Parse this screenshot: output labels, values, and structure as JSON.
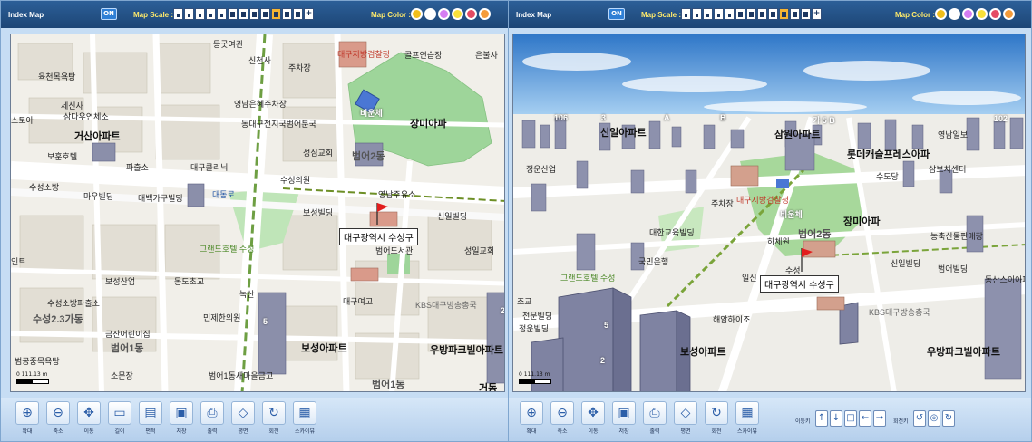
{
  "left": {
    "title": "Index Map",
    "on": "ON",
    "scale_label": "Map Scale :",
    "color_label": "Map Color :",
    "zoom_plus": "+",
    "callout": "대구광역시 수성구",
    "scalebar": "0 111.13 m",
    "labels": {
      "l01": "등굿여관",
      "l02": "신천사",
      "l03": "주차장",
      "l04": "대구지방검찰청",
      "l05": "골프연습장",
      "l06": "은불사",
      "l07": "육천목욕탕",
      "l08": "세신사",
      "l09": "삼다우연체소",
      "l10": "영남은혜주차장",
      "l11": "동대구전지국범어분국",
      "l12": "비운체",
      "l13": "장미아파",
      "l14": "거산아파트",
      "l15": "파출소",
      "l16": "성심교회",
      "l17": "범어2동",
      "l18": "보훈호텔",
      "l19": "대구클리닉",
      "l20": "수성의원",
      "l21": "영남주유소",
      "l22": "수성소방",
      "l23": "마우빌딩",
      "l24": "대백가구빌딩",
      "l25": "대동로",
      "l26": "보성빌딩",
      "l27": "신일빌딩",
      "l28": "그랜드호텔 수성",
      "l29": "범어도서관",
      "l30": "성일교회",
      "l31": "보성산업",
      "l32": "동도초교",
      "l33": "녹산",
      "l34": "대구여고",
      "l35": "KBS대구방송총국",
      "l36": "수성2.3가동",
      "l37": "민제한의원",
      "l38": "금잔어린이집",
      "l39": "범어1동",
      "l40": "보성아파트",
      "l41": "우방파크빌아파트",
      "l42": "범공중목욕탕",
      "l43": "소문장",
      "l44": "범어1동새마을금고",
      "l45": "범어1동",
      "l46": "수성소방파출소",
      "l47": "스토아",
      "l48": "인트",
      "l49": "5",
      "l50": "2",
      "l51": "거동"
    },
    "tools": [
      {
        "icon": "zoom-in-icon",
        "label": "확대"
      },
      {
        "icon": "zoom-out-icon",
        "label": "축소"
      },
      {
        "icon": "move-icon",
        "label": "이동"
      },
      {
        "icon": "ruler-icon",
        "label": "길이"
      },
      {
        "icon": "edit-icon",
        "label": "편적"
      },
      {
        "icon": "save-icon",
        "label": "저장"
      },
      {
        "icon": "print-icon",
        "label": "출력"
      },
      {
        "icon": "plane-icon",
        "label": "평면"
      },
      {
        "icon": "rotate-icon",
        "label": "회전"
      },
      {
        "icon": "skyview-icon",
        "label": "스카이뷰"
      }
    ],
    "map_colors": [
      "#f2bf1b",
      "#ffffff",
      "#d57df2",
      "#f8e13a",
      "#e44b63",
      "#f49b3a"
    ]
  },
  "right": {
    "title": "Index Map",
    "on": "ON",
    "scale_label": "Map Scale :",
    "color_label": "Map Color :",
    "zoom_plus": "+",
    "callout": "대구광역시 수성구",
    "scalebar": "0 111.13 m",
    "labels": {
      "r01": "106",
      "r02": "3",
      "r03": "A",
      "r04": "B",
      "r05": "신일아파트",
      "r06": "삼원아파트",
      "r07": "가 5 B",
      "r08": "102",
      "r09": "롯데캐슬프레스아파",
      "r10": "삼보치센터",
      "r11": "정운산업",
      "r12": "수도당",
      "r13": "대구지방검찰청",
      "r14": "주차장",
      "r15": "장미아파",
      "r16": "비운체",
      "r17": "범어2동",
      "r18": "하체원",
      "r19": "대한교육빌딩",
      "r20": "그랜드호텔 수성",
      "r21": "신일빌딩",
      "r22": "범어빌딩",
      "r23": "동산스이아파",
      "r24": "일신",
      "r25": "수성",
      "r26": "KBS대구방송총국",
      "r27": "해암하이조",
      "r28": "보성아파트",
      "r29": "우방파크빌아파트",
      "r30": "정운빌딩",
      "r31": "2",
      "r32": "5",
      "r33": "농축산물판매장",
      "r34": "조교",
      "r35": "국민은행",
      "r36": "전문빌딩",
      "r37": "영남일보"
    },
    "tools": [
      {
        "icon": "zoom-in-icon",
        "label": "확대"
      },
      {
        "icon": "zoom-out-icon",
        "label": "축소"
      },
      {
        "icon": "move-icon",
        "label": "이동"
      },
      {
        "icon": "save-icon",
        "label": "저장"
      },
      {
        "icon": "print-icon",
        "label": "출력"
      },
      {
        "icon": "plane-icon",
        "label": "평면"
      },
      {
        "icon": "rotate-icon",
        "label": "회전"
      },
      {
        "icon": "skyview-icon",
        "label": "스카이뷰"
      }
    ],
    "move_label": "이동키",
    "rotate_label": "회전키",
    "map_colors": [
      "#f2bf1b",
      "#ffffff",
      "#d57df2",
      "#f8e13a",
      "#e44b63",
      "#f49b3a"
    ]
  }
}
